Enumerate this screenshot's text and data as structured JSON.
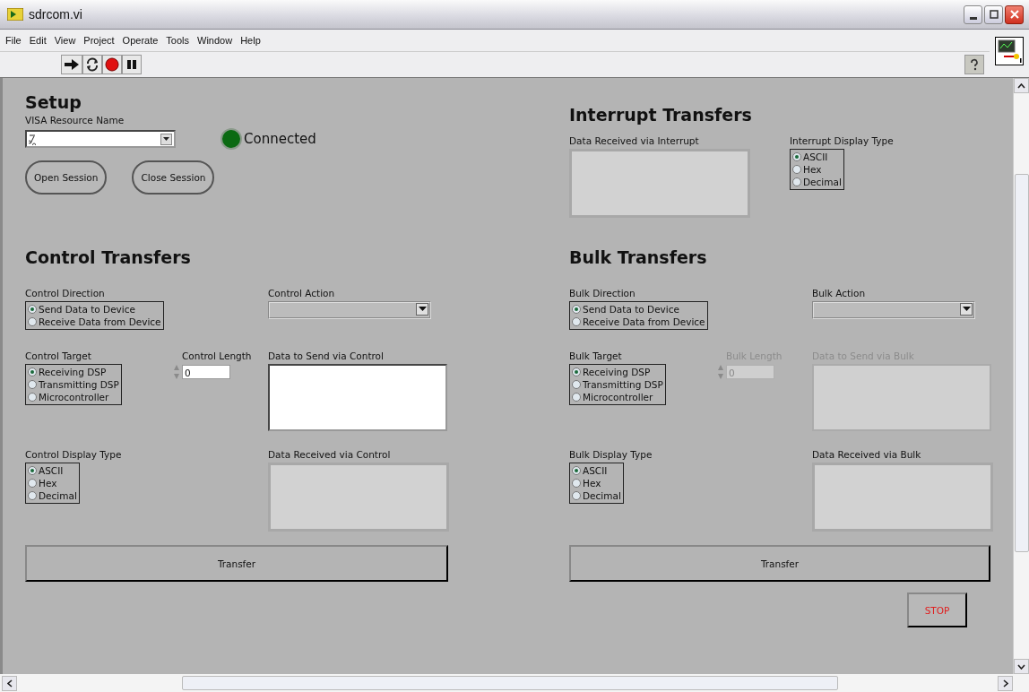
{
  "window": {
    "title": "sdrcom.vi"
  },
  "menu": [
    "File",
    "Edit",
    "View",
    "Project",
    "Operate",
    "Tools",
    "Window",
    "Help"
  ],
  "setup": {
    "title": "Setup",
    "resource_label": "VISA Resource Name",
    "led": {
      "on": true,
      "label": "Connected"
    },
    "buttons": [
      "Open Session",
      "Close Session"
    ]
  },
  "interrupt": {
    "title": "Interrupt Transfers",
    "received": {
      "label": "Data Received via Interrupt"
    },
    "display_type": {
      "label": "Interrupt Display Type",
      "options": [
        {
          "label": "ASCII",
          "selected": true
        },
        {
          "label": "Hex",
          "selected": false
        },
        {
          "label": "Decimal",
          "selected": false
        }
      ]
    }
  },
  "control": {
    "title": "Control Transfers",
    "direction": {
      "label": "Control Direction",
      "options": [
        {
          "label": "Send Data to Device",
          "selected": true
        },
        {
          "label": "Receive Data from Device",
          "selected": false
        }
      ]
    },
    "action": {
      "label": "Control Action"
    },
    "target": {
      "label": "Control Target",
      "options": [
        {
          "label": "Receiving DSP",
          "selected": true
        },
        {
          "label": "Transmitting DSP",
          "selected": false
        },
        {
          "label": "Microcontroller",
          "selected": false
        }
      ]
    },
    "length": {
      "label": "Control Length",
      "value": "0",
      "disabled": false
    },
    "send": {
      "label": "Data to Send via Control",
      "disabled": false
    },
    "display_type": {
      "label": "Control Display Type",
      "options": [
        {
          "label": "ASCII",
          "selected": true
        },
        {
          "label": "Hex",
          "selected": false
        },
        {
          "label": "Decimal",
          "selected": false
        }
      ]
    },
    "received": {
      "label": "Data Received via Control"
    },
    "transfer": "Transfer"
  },
  "bulk": {
    "title": "Bulk Transfers",
    "direction": {
      "label": "Bulk Direction",
      "options": [
        {
          "label": "Send Data to Device",
          "selected": true
        },
        {
          "label": "Receive Data from Device",
          "selected": false
        }
      ]
    },
    "action": {
      "label": "Bulk Action"
    },
    "target": {
      "label": "Bulk Target",
      "options": [
        {
          "label": "Receiving DSP",
          "selected": true
        },
        {
          "label": "Transmitting DSP",
          "selected": false
        },
        {
          "label": "Microcontroller",
          "selected": false
        }
      ]
    },
    "length": {
      "label": "Bulk Length",
      "value": "0",
      "disabled": true
    },
    "send": {
      "label": "Data to Send via Bulk",
      "disabled": true
    },
    "display_type": {
      "label": "Bulk Display Type",
      "options": [
        {
          "label": "ASCII",
          "selected": true
        },
        {
          "label": "Hex",
          "selected": false
        },
        {
          "label": "Decimal",
          "selected": false
        }
      ]
    },
    "received": {
      "label": "Data Received via Bulk"
    },
    "transfer": "Transfer"
  },
  "stop": "STOP"
}
